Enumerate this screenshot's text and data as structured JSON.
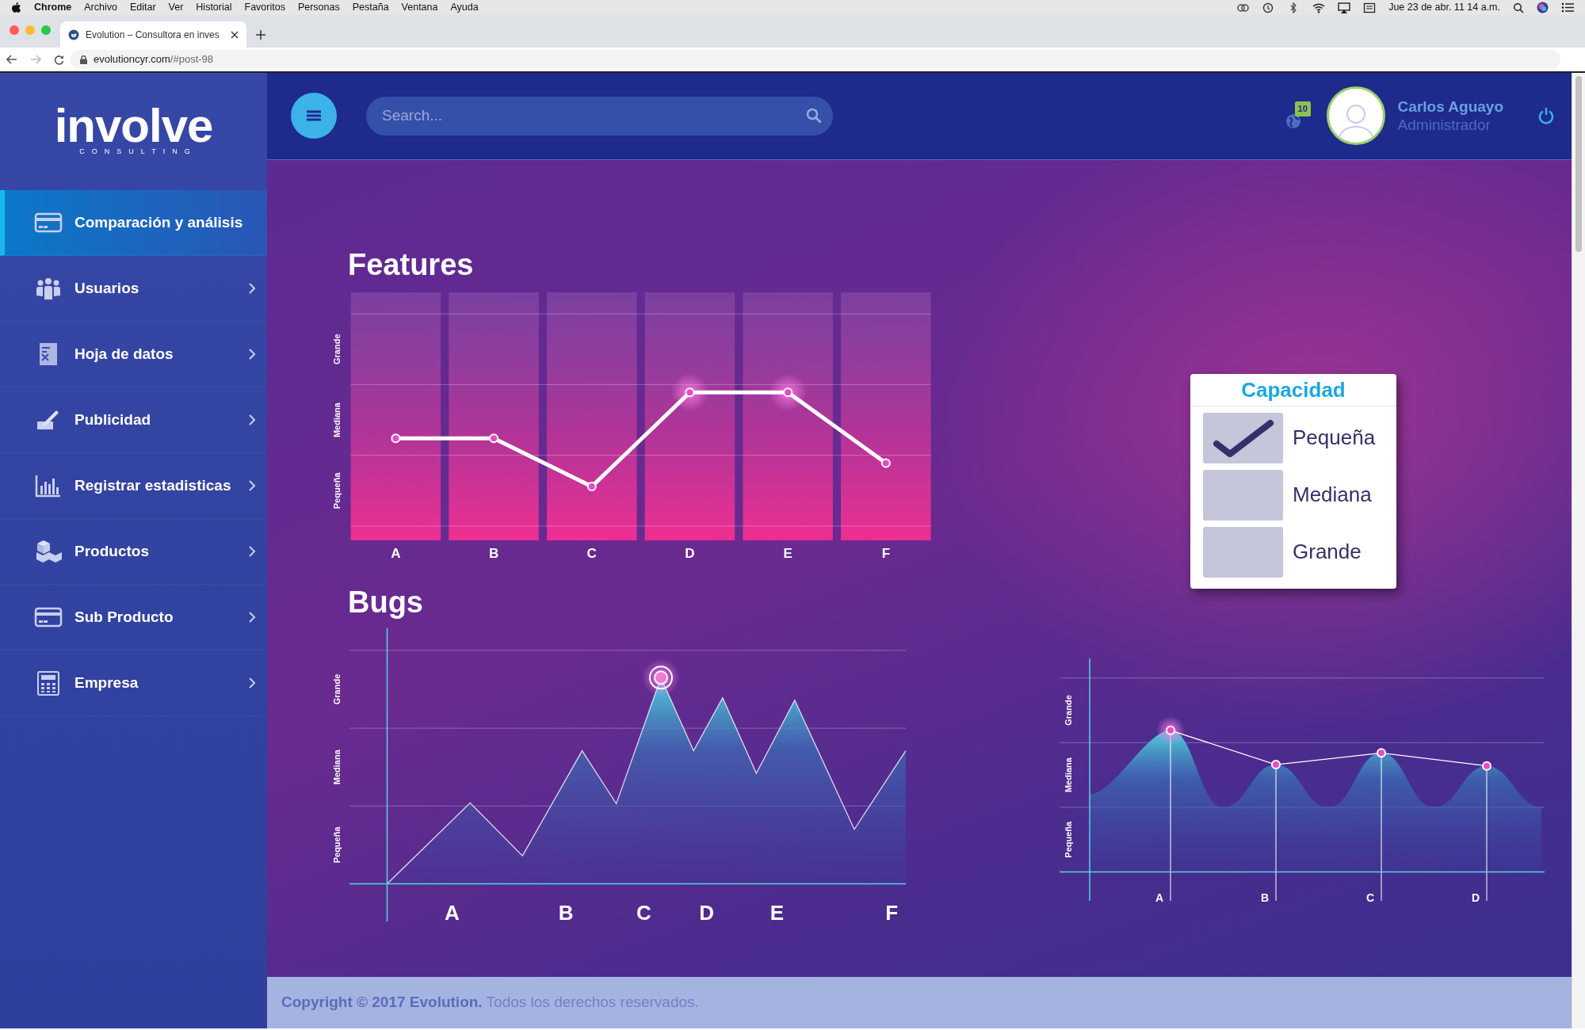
{
  "os_menu_bar": {
    "app": "Chrome",
    "menus": [
      "Archivo",
      "Editar",
      "Ver",
      "Historial",
      "Favoritos",
      "Personas",
      "Pestaña",
      "Ventana",
      "Ayuda"
    ],
    "clock": "Jue 23 de abr.  11 14 a.m."
  },
  "browser": {
    "tab_title": "Evolution – Consultora en inves",
    "url_host": "evolutioncyr.com",
    "url_path": "/#post-98"
  },
  "brand": {
    "logo": "involve",
    "tagline": "CONSULTING"
  },
  "sidebar": {
    "items": [
      {
        "label": "Comparación y análisis",
        "kind": "card",
        "selected": true,
        "has_submenu": false
      },
      {
        "label": "Usuarios",
        "kind": "users",
        "selected": false,
        "has_submenu": true
      },
      {
        "label": "Hoja de datos",
        "kind": "sheet",
        "selected": false,
        "has_submenu": true
      },
      {
        "label": "Publicidad",
        "kind": "pen",
        "selected": false,
        "has_submenu": true
      },
      {
        "label": "Registrar estadisticas",
        "kind": "bars",
        "selected": false,
        "has_submenu": true
      },
      {
        "label": "Productos",
        "kind": "boxes",
        "selected": false,
        "has_submenu": true
      },
      {
        "label": "Sub Producto",
        "kind": "card",
        "selected": false,
        "has_submenu": true
      },
      {
        "label": "Empresa",
        "kind": "calculator",
        "selected": false,
        "has_submenu": true
      }
    ]
  },
  "header": {
    "search": {
      "placeholder": "Search..."
    },
    "notifications": "10",
    "user": {
      "name": "Carlos Aguayo",
      "role": "Administrador"
    }
  },
  "features": {
    "title": "Features",
    "x_labels": [
      "A",
      "B",
      "C",
      "D",
      "E",
      "F"
    ],
    "y_labels": [
      "Pequeña",
      "Mediana",
      "Grande"
    ]
  },
  "bugs": {
    "title": "Bugs",
    "x_labels": [
      "A",
      "B",
      "C",
      "D",
      "E",
      "F"
    ],
    "y_labels": [
      "Pequeña",
      "Mediana",
      "Grande"
    ]
  },
  "capacity": {
    "title": "Capacidad",
    "options": [
      {
        "label": "Pequeña",
        "checked": true
      },
      {
        "label": "Mediana",
        "checked": false
      },
      {
        "label": "Grande",
        "checked": false
      }
    ]
  },
  "mini_chart": {
    "x_labels": [
      "A",
      "B",
      "C",
      "D"
    ],
    "y_labels": [
      "Pequeña",
      "Mediana",
      "Grande"
    ]
  },
  "footer": "**Copyright © 2017 Evolution.** Todos los derechos reservados."
}
